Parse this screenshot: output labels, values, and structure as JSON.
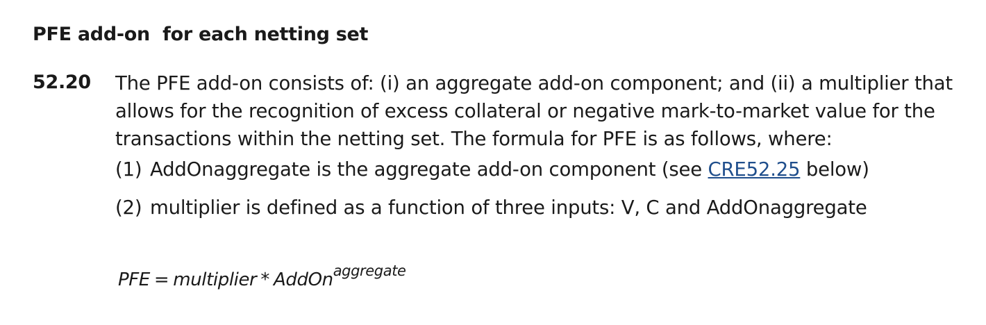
{
  "section": {
    "heading": "PFE add-on  for each netting set"
  },
  "paragraph": {
    "number": "52.20",
    "lines": [
      "The PFE add-on consists of: (i) an aggregate add-on component; and (ii) a multiplier that",
      "allows for the recognition of excess collateral or negative mark-to-market value for the",
      "transactions within the netting set. The formula for PFE is as follows, where:"
    ]
  },
  "list": [
    {
      "marker": "(1)",
      "text_before": "AddOnaggregate is the aggregate add-on component (see ",
      "link": "CRE52.25",
      "text_after": " below)"
    },
    {
      "marker": "(2)",
      "text": "multiplier is defined as a function of three inputs: V, C and AddOnaggregate"
    }
  ],
  "formula": {
    "lhs": "PFE",
    "equals": "=",
    "multiplier": "multiplier",
    "times": "*",
    "base": "AddOn",
    "superscript": "aggregate"
  }
}
